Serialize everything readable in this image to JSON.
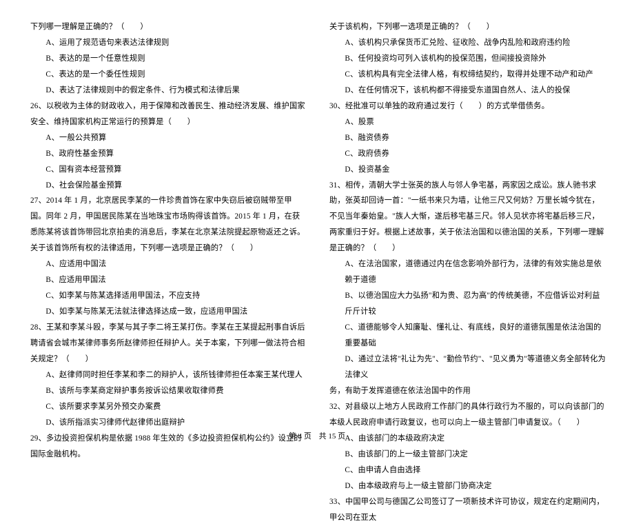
{
  "left": {
    "q25_stem_tail": "下列哪一理解是正确的？（　　）",
    "q25": {
      "A": "A、运用了规范语句来表达法律规则",
      "B": "B、表达的是一个任意性规则",
      "C": "C、表达的是一个委任性规则",
      "D": "D、表达了法律规则中的假定条件、行为模式和法律后果"
    },
    "q26_stem": "26、以税收为主体的财政收入，用于保障和改善民生、推动经济发展、维护国家安全、维持国家机构正常运行的预算是（　　）",
    "q26": {
      "A": "A、一般公共预算",
      "B": "B、政府性基金预算",
      "C": "C、国有资本经营预算",
      "D": "D、社会保险基金预算"
    },
    "q27_stem": "27、2014 年 1 月，北京居民李某的一件珍贵首饰在家中失窃后被窃贼带至甲国。同年 2 月，甲国居民陈某在当地珠宝市场购得该首饰。2015 年 1 月，在获悉陈某将该首饰带回北京拍卖的消息后，李某在北京某法院提起原物返还之诉。关于该首饰所有权的法律适用，下列哪一选项是正确的？（　　）",
    "q27": {
      "A": "A、应适用中国法",
      "B": "B、应适用甲国法",
      "C": "C、如李某与陈某选择适用甲国法，不应支持",
      "D": "D、如李某与陈某无法就法律选择达成一致，应适用甲国法"
    },
    "q28_stem": "28、王某和李某斗殴，李某与其子李二将王某打伤。李某在王某提起刑事自诉后聘请省会城市某律师事务所赵律师担任辩护人。关于本案，下列哪一做法符合相关规定？（　　）",
    "q28": {
      "A": "A、赵律师同时担任李某和李二的辩护人，该所钱律师担任本案王某代理人",
      "B": "B、该所与李某商定辩护事务按诉讼结果收取律师费",
      "C": "C、该所要求李某另外预交办案费",
      "D": "D、该所指派实习律师代赵律师出庭辩护"
    },
    "q29_stem": "29、多边投资担保机构是依据 1988 年生效的《多边投资担保机构公约》设立的国际金融机构。"
  },
  "right": {
    "q29_tail": "关于该机构，下列哪一选项是正确的？（　　）",
    "q29": {
      "A": "A、该机构只承保货币汇兑险、征收险、战争内乱险和政府违约险",
      "B": "B、任何投资均可列入该机构的投保范围，但间接投资除外",
      "C": "C、该机构具有完全法律人格，有权缔结契约，取得并处理不动产和动产",
      "D": "D、在任何情况下，该机构都不得接受东道国自然人、法人的投保"
    },
    "q30_stem": "30、经批准可以单独的政府通过发行（　　）的方式举借债务。",
    "q30": {
      "A": "A、股票",
      "B": "B、融资债券",
      "C": "C、政府债券",
      "D": "D、投资基金"
    },
    "q31_stem": "31、相传，清朝大学士张英的族人与邻人争宅基，两家因之成讼。族人驰书求助，张英却回诗一首：\"一纸书来只为墙，让他三尺又何妨？万里长城今犹在，不见当年秦始皇。\"族人大惭，遂后移宅基三尺。邻人见状亦将宅基后移三尺，两家重归于好。根据上述故事，关于依法治国和以德治国的关系，下列哪一理解是正确的？（　　）",
    "q31": {
      "A": "A、在法治国家，道德通过内在信念影响外部行为，法律的有效实施总是依赖于道德",
      "B": "B、以德治国应大力弘扬\"和为贵、忍为高\"的传统美德，不应借诉讼对利益斤斤计较",
      "C": "C、道德能够令人知廉耻、懂礼让、有底线，良好的道德氛围是依法治国的重要基础",
      "D_line1": "D、通过立法将\"礼让为先\"、\"勤俭节约\"、\"见义勇为\"等道德义务全部转化为法律义",
      "D_line2": "务，有助于发挥道德在依法治国中的作用"
    },
    "q32_stem": "32、对县级以上地方人民政府工作部门的具体行政行为不服的，可以向该部门的本级人民政府申请行政复议，也可以向上一级主管部门申请复议。（　　）",
    "q32": {
      "A": "A、由该部门的本级政府决定",
      "B": "B、由该部门的上一级主管部门决定",
      "C": "C、由申请人自由选择",
      "D": "D、由本级政府与上一级主管部门协商决定"
    },
    "q33_stem": "33、中国甲公司与德国乙公司签订了一项新技术许可协议，规定在约定期间内，甲公司在亚太"
  },
  "footer": {
    "left": "第 4 页",
    "right": "共 15 页"
  }
}
